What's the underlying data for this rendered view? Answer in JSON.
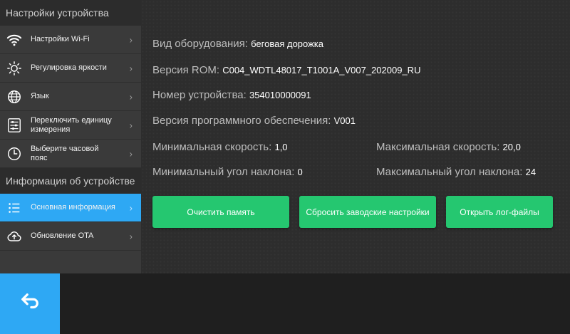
{
  "sidebar": {
    "section1": "Настройки устройства",
    "section2": "Информация об устройстве",
    "items": [
      {
        "label": "Настройки Wi-Fi",
        "icon": "wifi-icon"
      },
      {
        "label": "Регулировка яркости",
        "icon": "brightness-icon"
      },
      {
        "label": "Язык",
        "icon": "globe-icon"
      },
      {
        "label": "Переключить единицу измерения",
        "icon": "sliders-icon"
      },
      {
        "label": "Выберите часовой пояс",
        "icon": "clock-icon"
      },
      {
        "label": "Основная информация",
        "icon": "list-icon",
        "active": true
      },
      {
        "label": "Обновление OTA",
        "icon": "cloud-upload-icon"
      }
    ],
    "chevron": "›"
  },
  "info": {
    "equipment_label": "Вид оборудования:",
    "equipment_value": "беговая дорожка",
    "rom_label": "Версия ROM:",
    "rom_value": "C004_WDTL48017_T1001A_V007_202009_RU",
    "device_label": "Номер устройства:",
    "device_value": "354010000091",
    "software_label": "Версия программного обеспечения:",
    "software_value": "V001",
    "min_speed_label": "Минимальная скорость:",
    "min_speed_value": "1,0",
    "max_speed_label": "Максимальная скорость:",
    "max_speed_value": "20,0",
    "min_incline_label": "Минимальный угол наклона:",
    "min_incline_value": "0",
    "max_incline_label": "Максимальный угол наклона:",
    "max_incline_value": "24"
  },
  "buttons": {
    "clear_memory": "Очистить память",
    "factory_reset": "Сбросить заводские настройки",
    "open_logs": "Открыть лог-файлы"
  },
  "colors": {
    "accent": "#2ea8f4",
    "button_green": "#25c770"
  }
}
